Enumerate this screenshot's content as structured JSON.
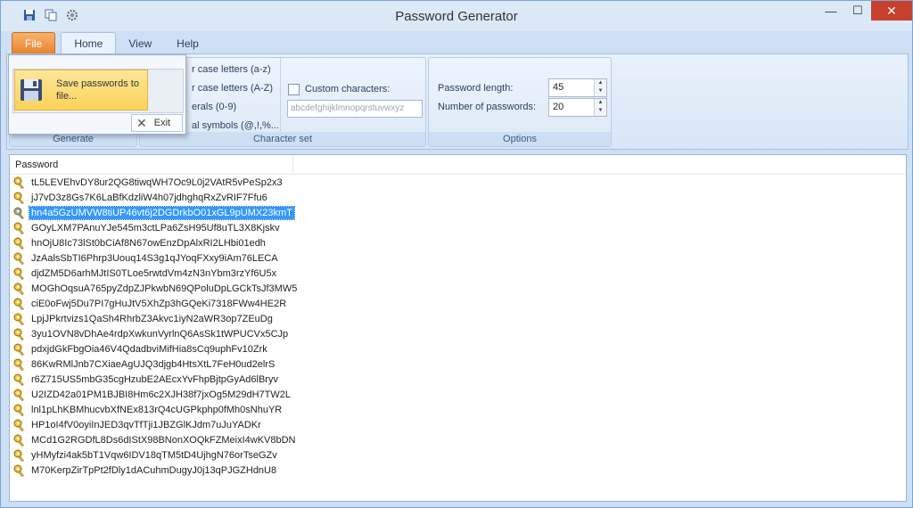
{
  "window": {
    "title": "Password Generator",
    "minimize": "—",
    "maximize": "☐",
    "close": "✕"
  },
  "tabs": [
    {
      "label": "File"
    },
    {
      "label": "Home"
    },
    {
      "label": "View"
    },
    {
      "label": "Help"
    }
  ],
  "ribbon": {
    "generate_group": {
      "label": "Generate"
    },
    "charset_group": {
      "label": "Character set",
      "lowercase": "r case letters (a-z)",
      "uppercase": "r case letters (A-Z)",
      "numerals": "erals (0-9)",
      "symbols": "al symbols (@,!,%...",
      "custom_label": "Custom characters:",
      "custom_value": "abcdefghijklmnopqrstuvwxyz"
    },
    "options_group": {
      "label": "Options",
      "length_label": "Password length:",
      "length_value": "45",
      "count_label": "Number of passwords:",
      "count_value": "20"
    }
  },
  "file_menu": {
    "save_label": "Save passwords to file...",
    "exit_label": "Exit"
  },
  "list": {
    "column_header": "Password",
    "selected_index": 2,
    "rows": [
      "tL5LEVEhvDY8ur2QG8tiwqWH7Oc9L0j2VAtR5vPeSp2x3",
      "jJ7vD3z8Gs7K6LaBfKdzliW4h07jdhghqRxZvRIF7Ffu6",
      "hn4a5GzUMVW8tiUP46vt6j2DGDrkbO01xGL9pUMX23kmT",
      "GOyLXM7PAnuYJe545m3ctLPa6ZsH95Uf8uTL3X8Kjskv",
      "hnOjU8Ic73lSt0bCiAf8N67owEnzDpAlxRI2LHbi01edh",
      "JzAalsSbTI6Phrp3Uouq14S3g1qJYoqFXxy9iAm76LECA",
      "djdZM5D6arhMJtIS0TLoe5rwtdVm4zN3nYbm3rzYf6U5x",
      "MOGhOqsuA765pyZdpZJPkwbN69QPoluDpLGCkTsJf3MW5",
      "ciE0oFwj5Du7PI7gHuJtV5XhZp3hGQeKi7318FWw4HE2R",
      "LpjJPkrtvizs1QaSh4RhrbZ3Akvc1iyN2aWR3op7ZEuDg",
      "3yu1OVN8vDhAe4rdpXwkunVyrlnQ6AsSk1tWPUCVx5CJp",
      "pdxjdGkFbgOia46V4QdadbviMifHia8sCq9uphFv10Zrk",
      "86KwRMlJnb7CXiaeAgUJQ3djgb4HtsXtL7FeH0ud2elrS",
      "r6Z715US5mbG35cgHzubE2AEcxYvFhpBjtpGyAd6lBryv",
      "U2IZD42a01PM1BJBI8Hm6c2XJH38f7jxOg5M29dH7TW2L",
      "lnl1pLhKBMhucvbXfNEx813rQ4cUGPkphp0fMh0sNhuYR",
      "HP1oI4fV0oyiInJED3qvTfTji1JBZGlKJdm7uJuYADKr",
      "MCd1G2RGDfL8Ds6dIStX98BNonXOQkFZMeixI4wKV8bDN",
      "yHMyfzi4ak5bT1Vqw6IDV18qTM5tD4UjhgN76orTseGZv",
      "M70KerpZirTpPt2fDly1dACuhmDugyJ0j13qPJGZHdnU8"
    ]
  },
  "colors": {
    "selection": "#3399ff",
    "file_tab": "#e8822c",
    "close_button": "#c7402e"
  }
}
